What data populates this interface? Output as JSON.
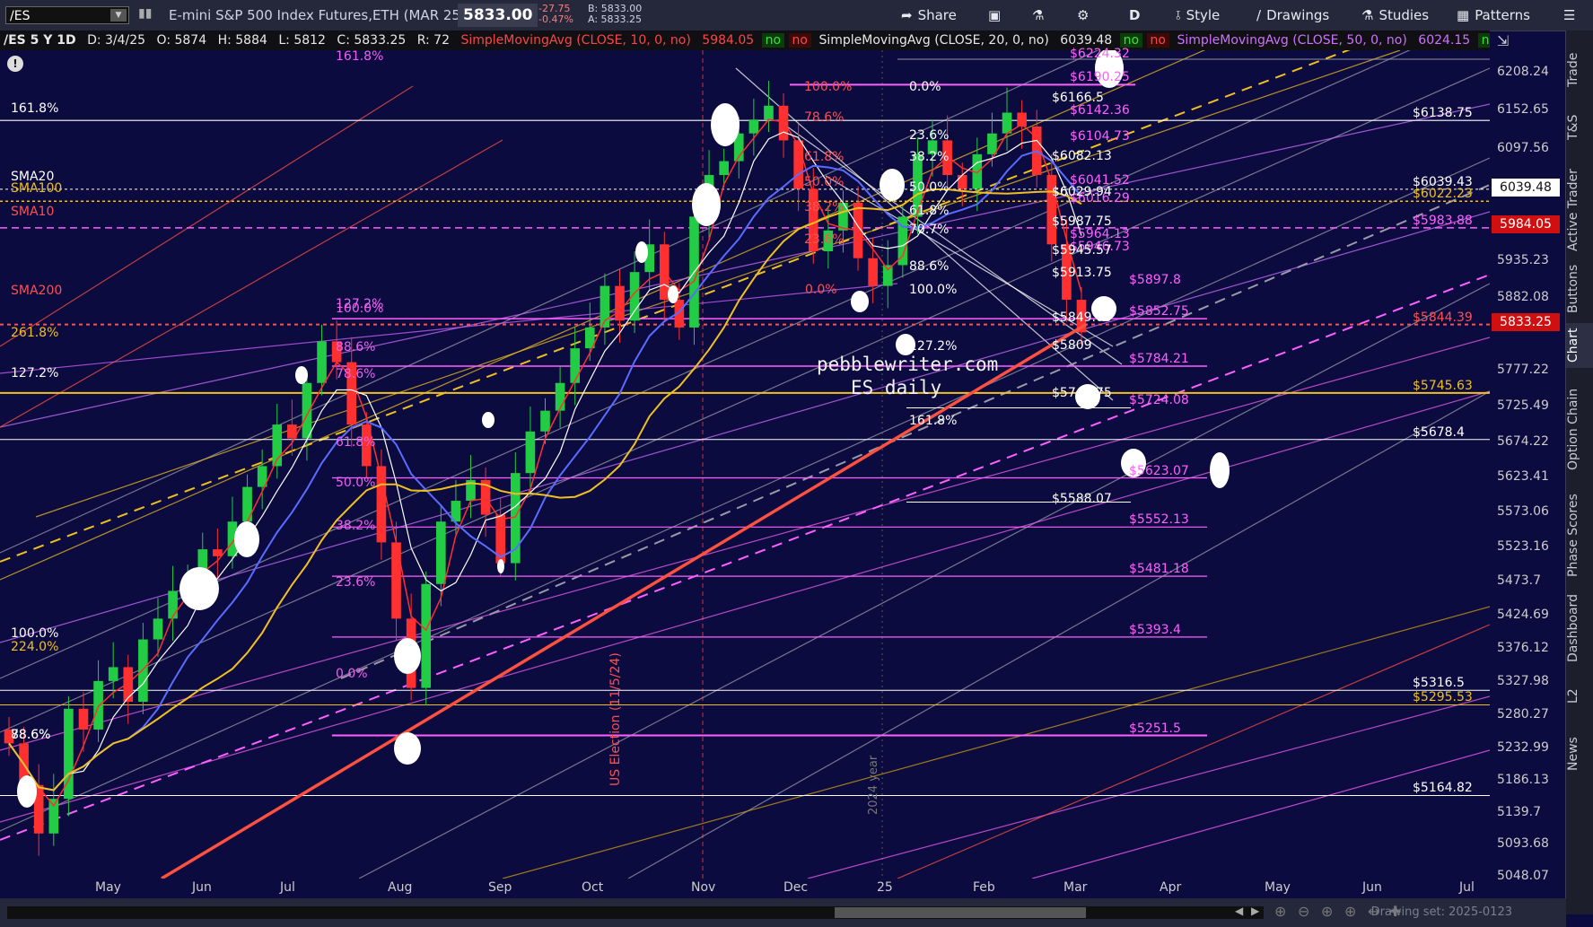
{
  "toolbar": {
    "symbol": "/ES",
    "instrument_name": "E-mini S&P 500 Index Futures,ETH (MAR 25)",
    "last_price": "5833.00",
    "change": "-27.75",
    "change_pct": "-0.47%",
    "bid": "B: 5833.00",
    "ask": "A: 5833.25",
    "share_label": "Share",
    "period_label": "D",
    "style_label": "Style",
    "drawings_label": "Drawings",
    "studies_label": "Studies",
    "patterns_label": "Patterns"
  },
  "legend": {
    "header": "/ES 5 Y 1D",
    "date": "D: 3/4/25",
    "open": "O: 5874",
    "high": "H: 5884",
    "low": "L: 5812",
    "close": "C: 5833.25",
    "range": "R: 72",
    "sma10_label": "SimpleMovingAvg (CLOSE, 10, 0, no)",
    "sma10_value": "5984.05",
    "sma20_label": "SimpleMovingAvg (CLOSE, 20, 0, no)",
    "sma20_value": "6039.48",
    "sma50_label": "SimpleMovingAvg (CLOSE, 50, 0, no)",
    "sma50_value": "6024.15",
    "no_label": "no",
    "more_label": "..."
  },
  "sidebar": {
    "tabs": [
      "Trade",
      "T&S",
      "Active Trader",
      "Buttons",
      "Chart",
      "Option Chain",
      "Phase Scores",
      "Dashboard",
      "L2",
      "News"
    ]
  },
  "price_axis": {
    "ticks": [
      "6208.24",
      "6152.65",
      "6097.56",
      "5935.23",
      "5882.08",
      "5777.22",
      "5725.49",
      "5674.22",
      "5623.41",
      "5573.06",
      "5523.16",
      "5473.7",
      "5424.69",
      "5376.12",
      "5327.98",
      "5280.27",
      "5232.99",
      "5186.13",
      "5139.7",
      "5093.68",
      "5048.07"
    ],
    "sma20_box": "6039.48",
    "sma10_box": "5984.05",
    "last_box": "5833.25"
  },
  "time_axis": {
    "labels": [
      "May",
      "Jun",
      "Jul",
      "Aug",
      "Sep",
      "Oct",
      "Nov",
      "Dec",
      "25",
      "Feb",
      "Mar",
      "Apr",
      "May",
      "Jun",
      "Jul"
    ]
  },
  "annotations": {
    "watermark_line1": "pebblewriter.com",
    "watermark_line2": "ES daily",
    "election_label": "US Election (11/5/24)",
    "year_label": "2024 year",
    "sma20": "SMA20",
    "sma100": "SMA100",
    "sma10": "SMA10",
    "sma200": "SMA200"
  },
  "fib_left": [
    "161.8%",
    "127.2%",
    "100.0%",
    "88.6%",
    "78.6%",
    "61.8%",
    "50.0%",
    "38.2%",
    "23.6%",
    "0.0%"
  ],
  "fib_far_left": [
    "161.8%",
    "261.8%",
    "127.2%",
    "100.0%",
    "224.0%",
    "88.6%",
    "78.6%"
  ],
  "fib_mid": [
    "100.0%",
    "78.6%",
    "61.8%",
    "50.0%",
    "38.2%",
    "23.6%",
    "0.0%"
  ],
  "fib_right": [
    "0.0%",
    "23.6%",
    "38.2%",
    "50.0%",
    "61.8%",
    "70.7%",
    "88.6%",
    "100.0%",
    "127.2%",
    "161.8%"
  ],
  "right_levels": [
    "$6138.75",
    "$6039.43",
    "$6022.23",
    "$5983.88",
    "$5844.39",
    "$5745.63",
    "$5678.4",
    "$5316.5",
    "$5295.53",
    "$5164.82"
  ],
  "magenta_levels": [
    "$6224.32",
    "$6190.25",
    "$6142.36",
    "$6104.73",
    "$6041.52",
    "$6016.29",
    "$5964.13",
    "$5946.73",
    "$5897.8",
    "$5852.75",
    "$5784.21",
    "$5724.08",
    "$5623.07",
    "$5552.13",
    "$5481.18",
    "$5393.4",
    "$5251.5"
  ],
  "white_levels": [
    "$6166.5",
    "$6082.13",
    "$6029.94",
    "$5987.75",
    "$5945.57",
    "$5913.75",
    "$5849.03",
    "$5809",
    "$5740.75",
    "$5588.07"
  ],
  "drawing_set": "Drawing set: 2025-0123",
  "chart_data": {
    "type": "candlestick",
    "title": "",
    "xlabel": "",
    "ylabel": "",
    "x_range": [
      "Apr 2024",
      "Jul 2025"
    ],
    "ylim": [
      5045,
      6240
    ],
    "last_close": 5833.25,
    "series": [
      {
        "name": "SMA10",
        "last": 5984.05
      },
      {
        "name": "SMA20",
        "last": 6039.48
      },
      {
        "name": "SMA50",
        "last": 6024.15
      },
      {
        "name": "SMA200",
        "last": 5844.39
      }
    ],
    "closes": [
      5240,
      5180,
      5110,
      5160,
      5290,
      5260,
      5330,
      5350,
      5300,
      5390,
      5420,
      5460,
      5480,
      5520,
      5510,
      5560,
      5610,
      5640,
      5700,
      5680,
      5760,
      5820,
      5790,
      5700,
      5640,
      5530,
      5420,
      5320,
      5470,
      5560,
      5590,
      5620,
      5570,
      5500,
      5630,
      5690,
      5720,
      5760,
      5810,
      5840,
      5900,
      5850,
      5920,
      5960,
      5880,
      5840,
      6000,
      6060,
      6080,
      6120,
      6140,
      6160,
      6110,
      6040,
      5950,
      5980,
      6020,
      5940,
      5900,
      5930,
      6000,
      6090,
      6110,
      6060,
      6040,
      6090,
      6120,
      6150,
      6130,
      6060,
      5960,
      5880,
      5833
    ]
  }
}
